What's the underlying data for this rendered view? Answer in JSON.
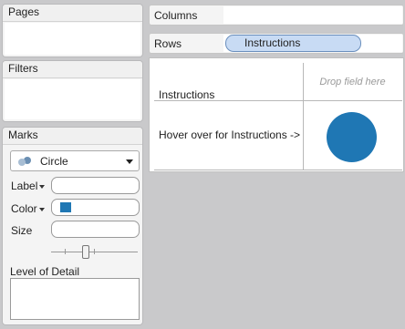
{
  "pages": {
    "title": "Pages"
  },
  "filters": {
    "title": "Filters"
  },
  "marks": {
    "title": "Marks",
    "mark_type": "Circle",
    "mark_type_icon": "circle-marks-icon",
    "label_btn": "Label",
    "color_btn": "Color",
    "size_btn": "Size",
    "color_swatch": "#1f77b4",
    "size_slider": {
      "value": 0.4
    },
    "level_of_detail": "Level of Detail"
  },
  "shelves": {
    "columns_label": "Columns",
    "rows_label": "Rows",
    "rows_pill": "Instructions"
  },
  "view": {
    "row_header": "Instructions",
    "row_value": "Hover over for Instructions ->",
    "drop_hint": "Drop field here",
    "mark_color": "#1f77b4"
  }
}
